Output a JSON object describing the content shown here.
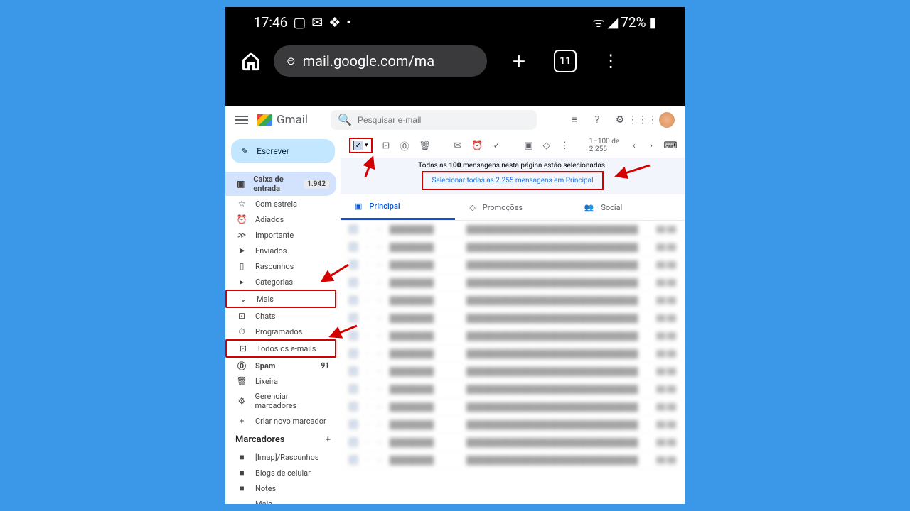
{
  "status": {
    "time": "17:46",
    "battery": "72%"
  },
  "browser": {
    "url": "mail.google.com/ma",
    "tab_count": "11"
  },
  "header": {
    "app_name": "Gmail",
    "search_placeholder": "Pesquisar e-mail"
  },
  "compose": {
    "label": "Escrever"
  },
  "sidebar": {
    "items": [
      {
        "label": "Caixa de entrada",
        "count": "1.942"
      },
      {
        "label": "Com estrela"
      },
      {
        "label": "Adiados"
      },
      {
        "label": "Importante"
      },
      {
        "label": "Enviados"
      },
      {
        "label": "Rascunhos"
      },
      {
        "label": "Categorias"
      },
      {
        "label": "Mais"
      },
      {
        "label": "Chats"
      },
      {
        "label": "Programados"
      },
      {
        "label": "Todos os e-mails"
      },
      {
        "label": "Spam",
        "count": "91"
      },
      {
        "label": "Lixeira"
      },
      {
        "label": "Gerenciar marcadores"
      },
      {
        "label": "Criar novo marcador"
      }
    ],
    "section_labels": "Marcadores",
    "labels": [
      {
        "label": "[Imap]/Rascunhos"
      },
      {
        "label": "Blogs de celular"
      },
      {
        "label": "Notes"
      },
      {
        "label": "Mais"
      }
    ]
  },
  "toolbar": {
    "page_info": "1–100 de 2.255"
  },
  "banner": {
    "text_a": "Todas as ",
    "text_b": "100",
    "text_c": " mensagens nesta página estão selecionadas.",
    "link": "Selecionar todas as 2.255 mensagens em Principal"
  },
  "tabs": [
    {
      "label": "Principal"
    },
    {
      "label": "Promoções"
    },
    {
      "label": "Social"
    }
  ],
  "mail_rows": [
    "",
    "",
    "",
    "",
    "",
    "",
    "",
    "",
    "",
    "",
    "",
    "",
    "",
    ""
  ]
}
